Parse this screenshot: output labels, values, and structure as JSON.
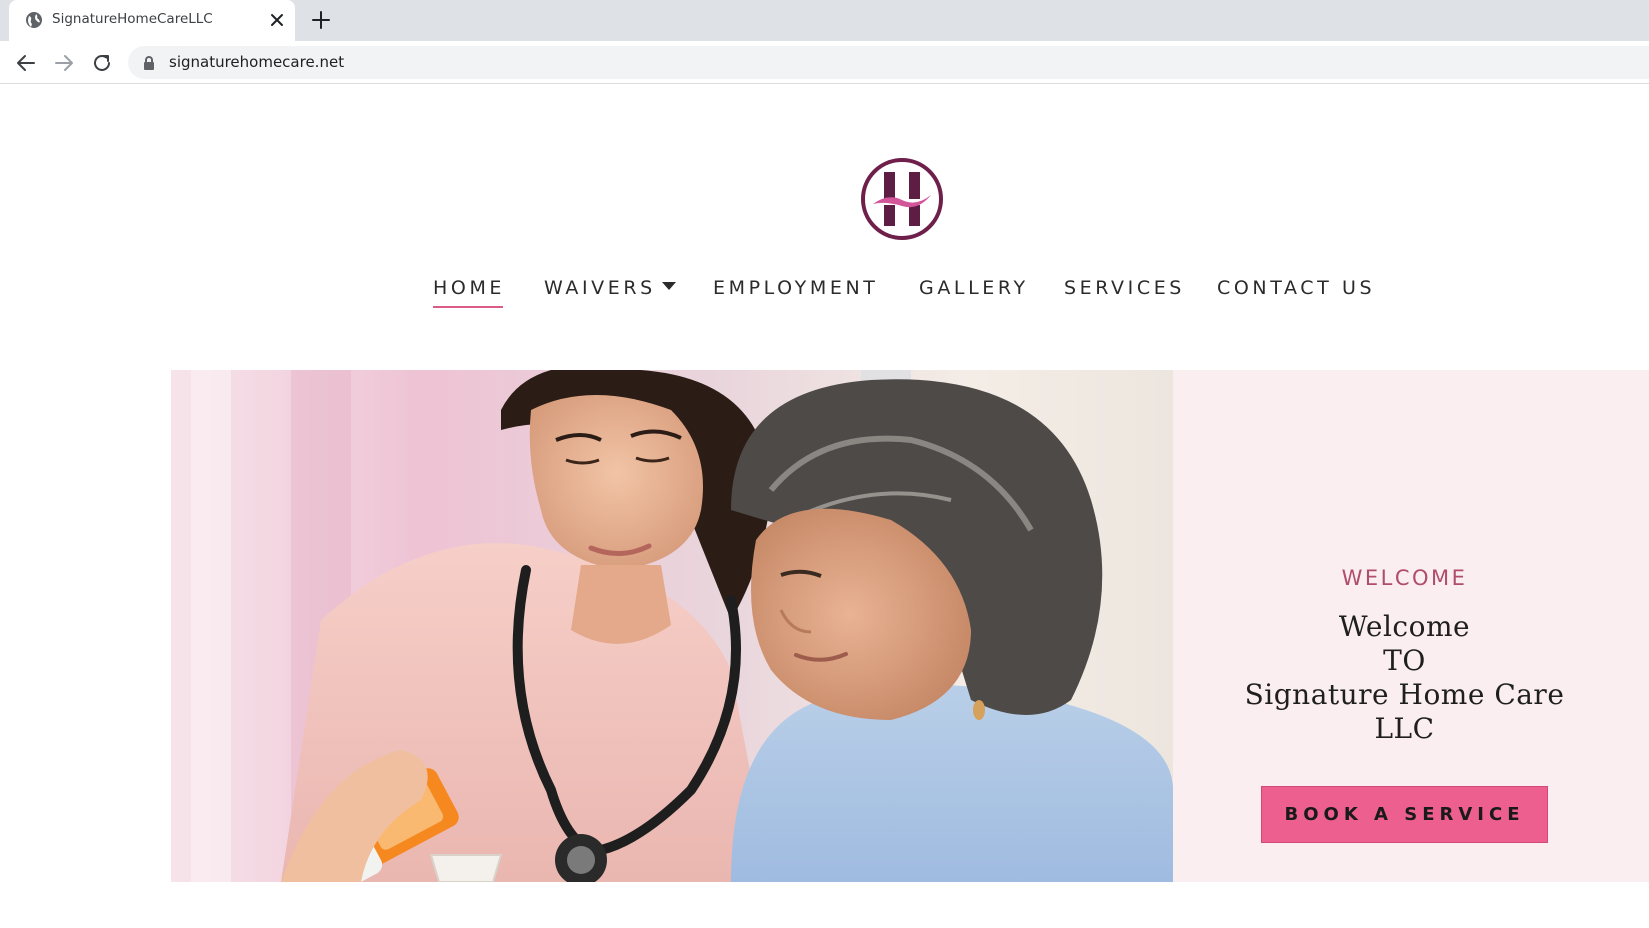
{
  "browser": {
    "tab_title": "SignatureHomeCareLLC",
    "url": "signaturehomecare.net",
    "icons": [
      "globe-icon",
      "close-icon",
      "plus-icon",
      "arrow-left-icon",
      "arrow-right-icon",
      "reload-icon",
      "lock-icon"
    ]
  },
  "site": {
    "nav": {
      "home": "HOME",
      "waivers": "WAIVERS",
      "employment": "EMPLOYMENT",
      "gallery": "GALLERY",
      "services": "SERVICES",
      "contact": "CONTACT US"
    },
    "hero": {
      "kicker": "WELCOME",
      "heading_lines": [
        "Welcome",
        "TO",
        "Signature Home Care",
        "LLC"
      ],
      "cta": "BOOK A SERVICE"
    },
    "colors": {
      "accent": "#ed5f8e",
      "panel_bg": "#fbeef1",
      "kicker": "#b04c6d",
      "logo": "#6e1f4a"
    }
  }
}
